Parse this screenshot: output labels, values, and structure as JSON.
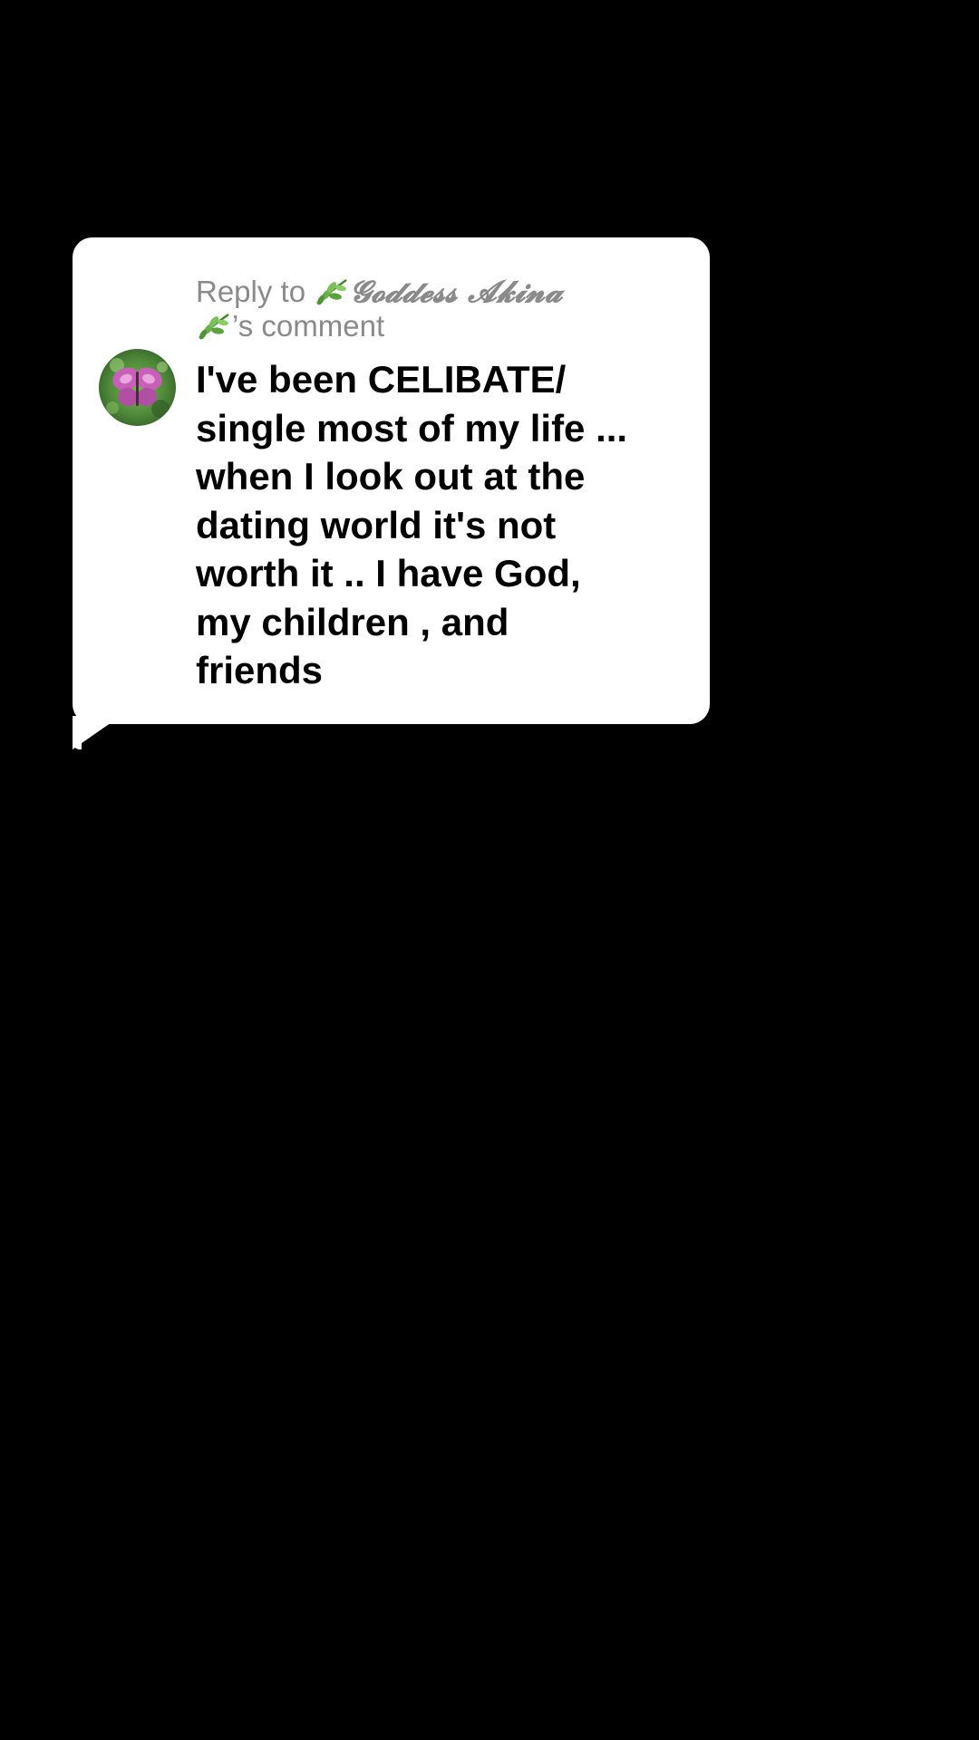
{
  "reply": {
    "prefix": "Reply to ",
    "username": "𝓖𝓸𝓭𝓭𝓮𝓼𝓼 𝓐𝓴𝓲𝓷𝓪",
    "suffix": "’s comment",
    "leaf_icon": "herb-leaf-emoji"
  },
  "comment": {
    "lines": [
      "I've been CELIBATE/",
      "single most of my life ...",
      "when I look out at the",
      "dating world it's not",
      "worth it .. I have God,",
      "my children , and",
      "friends"
    ]
  },
  "avatar": {
    "icon": "butterfly-avatar",
    "colors": {
      "background": "#4f8a3a",
      "wings": "#c85fb8"
    }
  },
  "colors": {
    "page_background": "#000000",
    "bubble": "#ffffff",
    "header_text": "#8a8a8a",
    "comment_text": "#000000"
  }
}
